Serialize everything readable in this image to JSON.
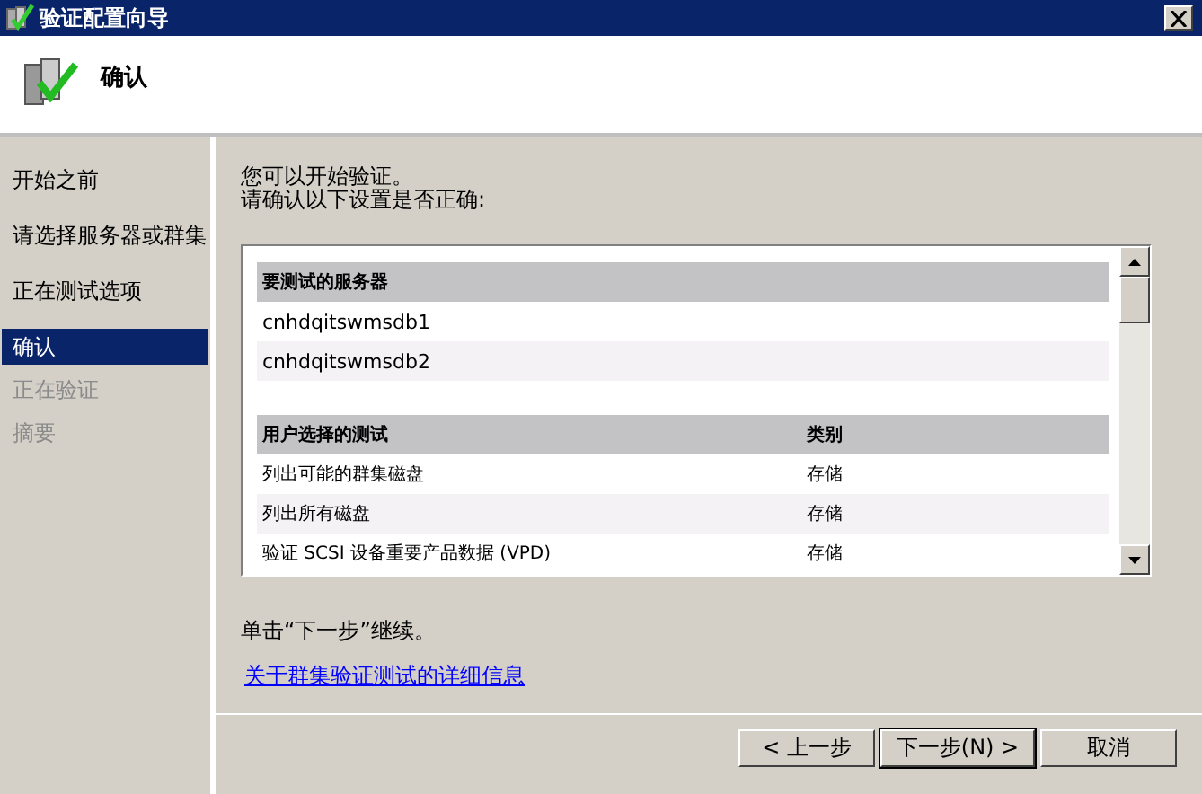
{
  "window": {
    "title": "验证配置向导"
  },
  "header": {
    "title": "确认"
  },
  "sidebar": {
    "items": [
      {
        "label": "开始之前",
        "selected": false,
        "disabled": false
      },
      {
        "label": "请选择服务器或群集",
        "selected": false,
        "disabled": false
      },
      {
        "label": "正在测试选项",
        "selected": false,
        "disabled": false
      },
      {
        "label": "确认",
        "selected": true,
        "disabled": false
      },
      {
        "label": "正在验证",
        "selected": false,
        "disabled": true
      },
      {
        "label": "摘要",
        "selected": false,
        "disabled": true
      }
    ]
  },
  "intro": [
    "您可以开始验证。",
    "请确认以下设置是否正确:"
  ],
  "report": {
    "sections": [
      {
        "columns": [
          "要测试的服务器"
        ],
        "rows": [
          [
            "cnhdqitswmsdb1"
          ],
          [
            "cnhdqitswmsdb2"
          ]
        ]
      },
      {
        "columns": [
          "用户选择的测试",
          "类别"
        ],
        "rows": [
          [
            "列出可能的群集磁盘",
            "存储"
          ],
          [
            "列出所有磁盘",
            "存储"
          ],
          [
            "验证 SCSI 设备重要产品数据 (VPD)",
            "存储"
          ]
        ]
      }
    ]
  },
  "hint": "单击“下一步”继续。",
  "link": "关于群集验证测试的详细信息",
  "buttons": [
    {
      "label": "< 上一步",
      "default": false
    },
    {
      "label": "下一步(N) >",
      "default": true
    },
    {
      "label": "取消",
      "default": false
    }
  ]
}
